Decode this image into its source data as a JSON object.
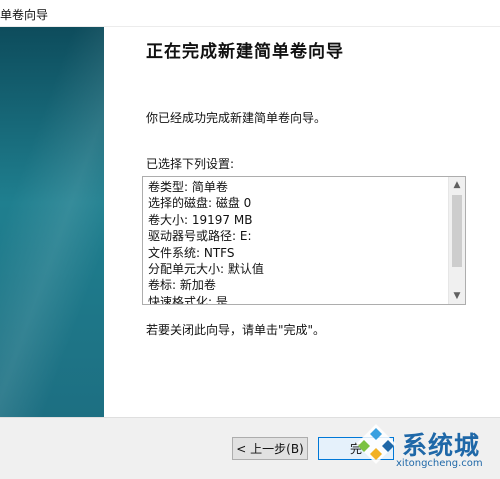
{
  "window": {
    "title": "单卷向导"
  },
  "wizard": {
    "heading": "正在完成新建简单卷向导",
    "description": "你已经成功完成新建简单卷向导。",
    "settings_label": "已选择下列设置:",
    "settings": [
      "卷类型: 简单卷",
      "选择的磁盘: 磁盘 0",
      "卷大小: 19197 MB",
      "驱动器号或路径: E:",
      "文件系统: NTFS",
      "分配单元大小: 默认值",
      "卷标: 新加卷",
      "快速格式化: 是"
    ],
    "close_hint": "若要关闭此向导，请单击\"完成\"。"
  },
  "footer": {
    "back_label": "< 上一步(B)",
    "finish_label": "完"
  },
  "watermark": {
    "brand": "系统城",
    "url": "xitongcheng.com"
  },
  "colors": {
    "side_panel": "#1f7f8f",
    "watermark": "#1f68a8"
  }
}
